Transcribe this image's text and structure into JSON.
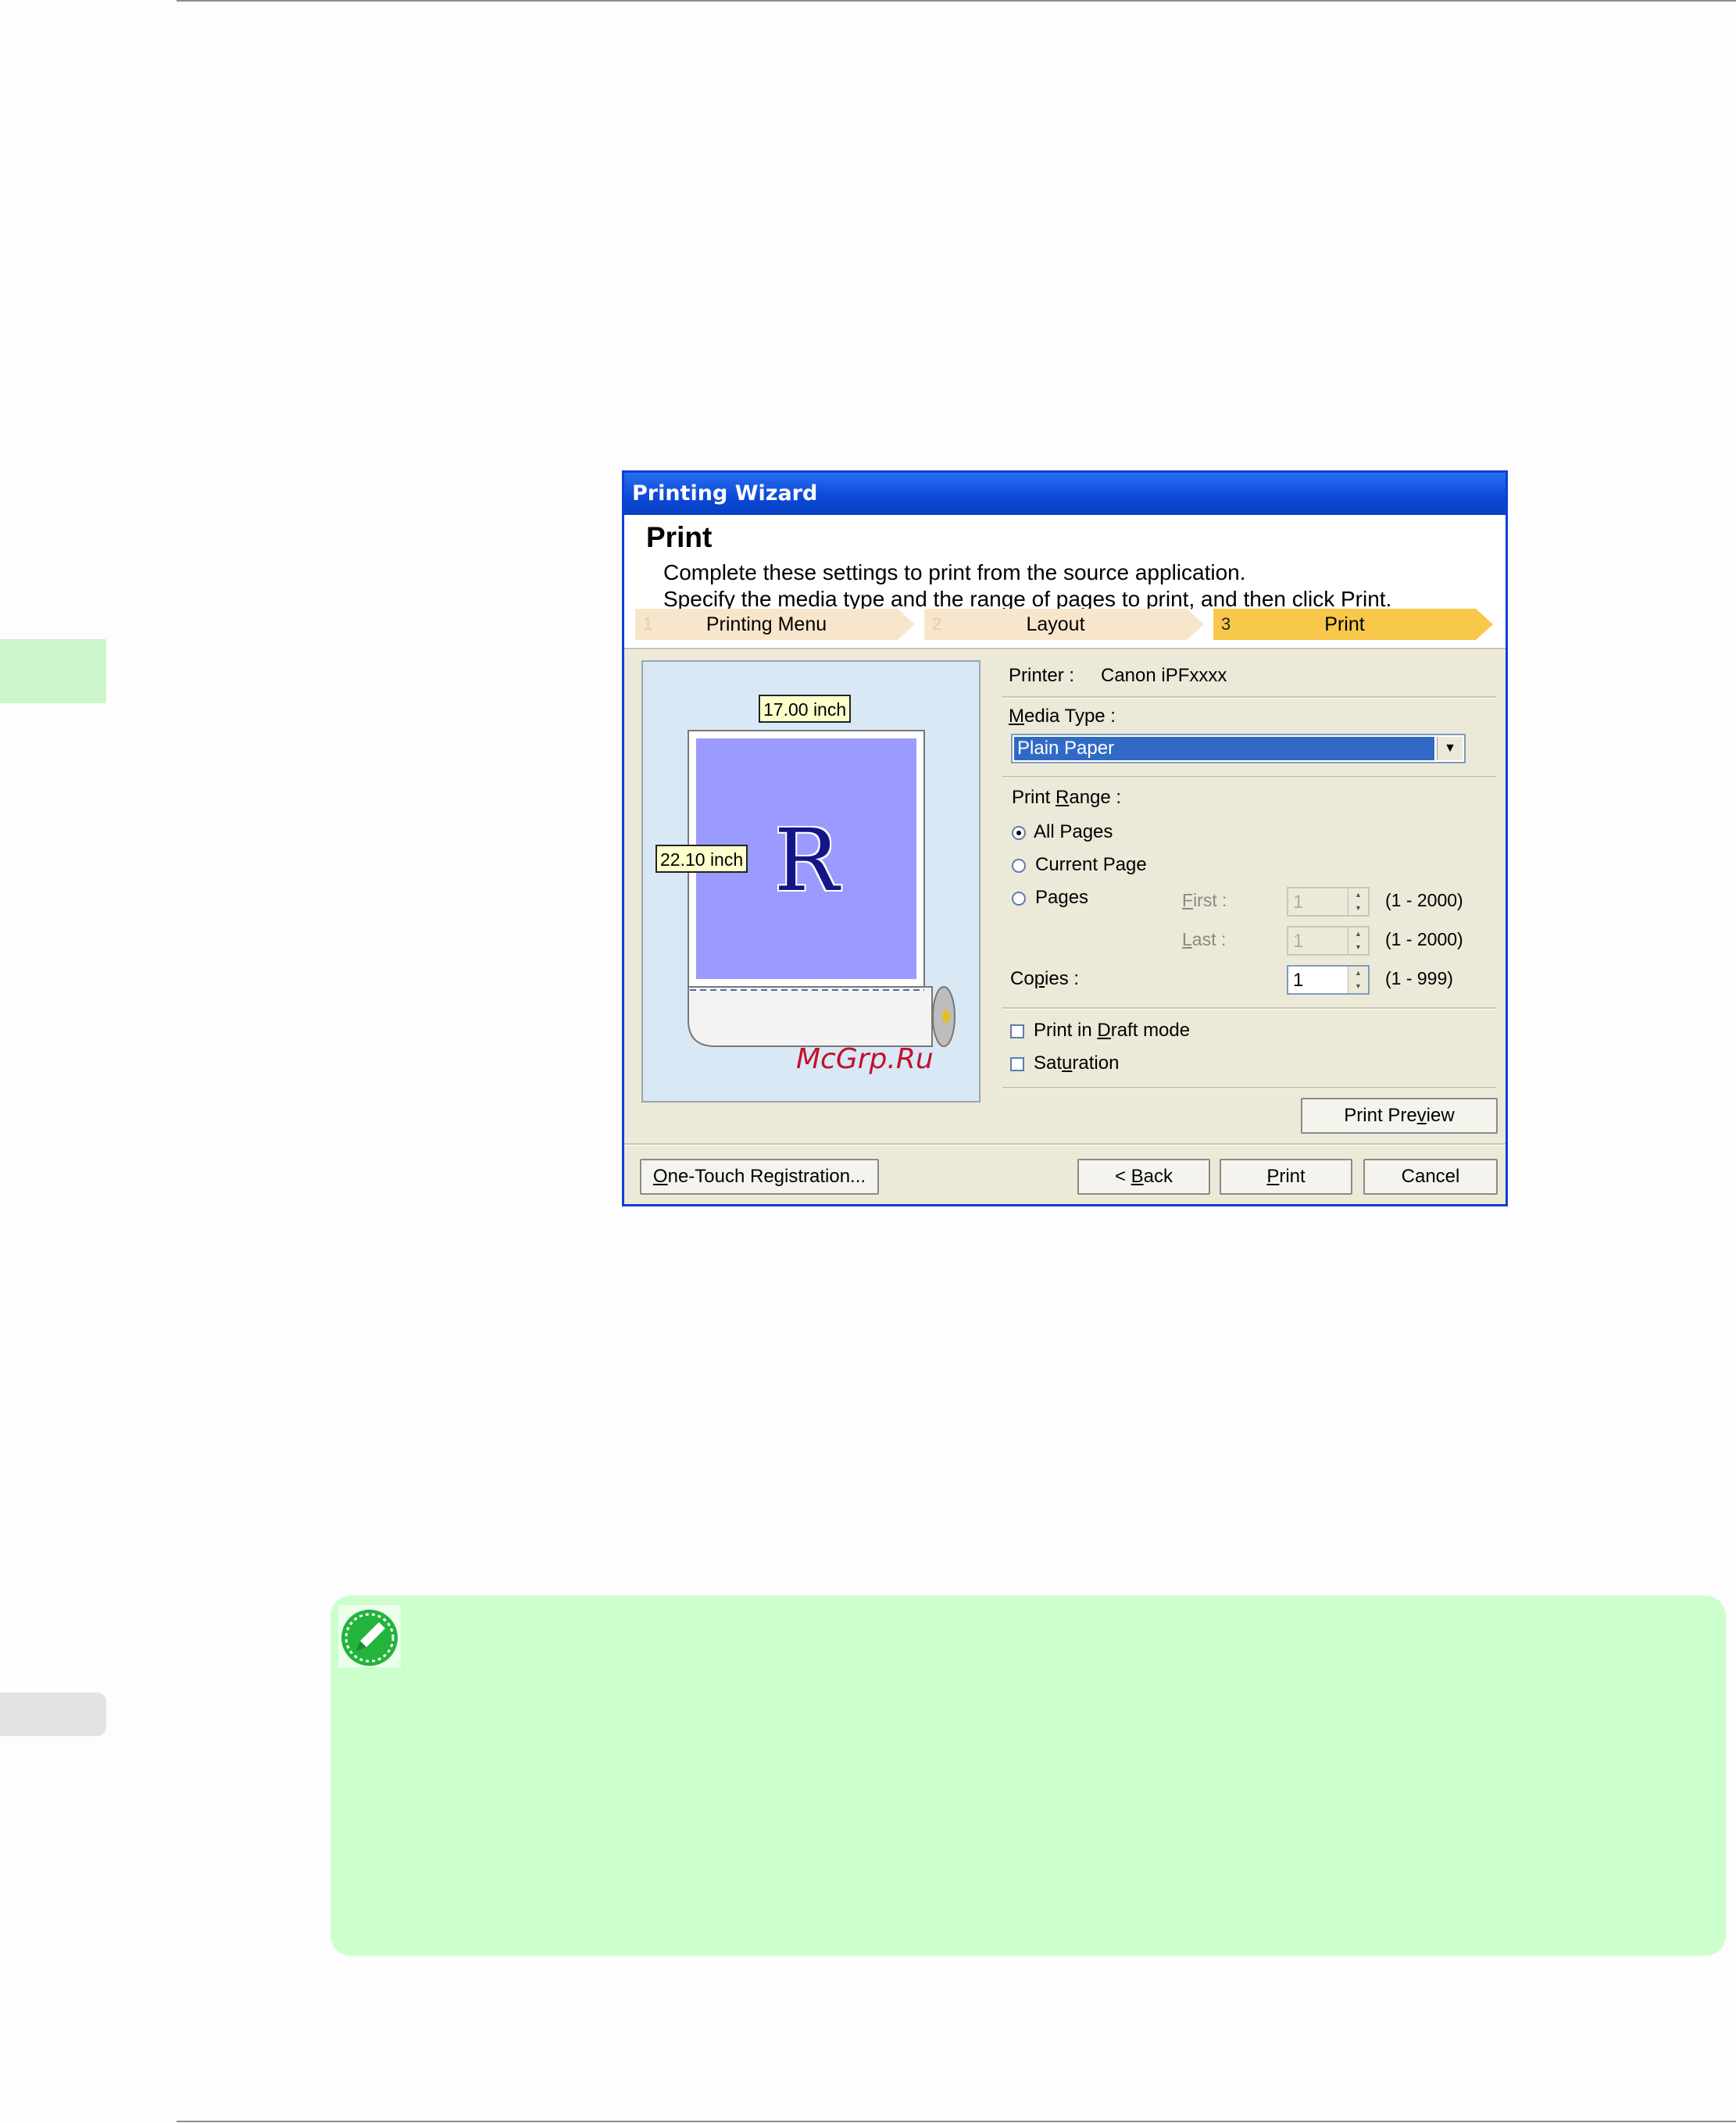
{
  "dialog": {
    "title": "Printing Wizard",
    "header_title": "Print",
    "header_line1": "Complete these settings to print from the source application.",
    "header_line2": "Specify the media type and the range of pages to print, and then click Print.",
    "steps": [
      {
        "num": "1",
        "label": "Printing Menu",
        "active": false
      },
      {
        "num": "2",
        "label": "Layout",
        "active": false
      },
      {
        "num": "3",
        "label": "Print",
        "active": true
      }
    ],
    "preview": {
      "width_label": "17.00 inch",
      "height_label": "22.10 inch",
      "letter": "R",
      "watermark": "McGrp.Ru"
    },
    "printer_label": "Printer :",
    "printer_value": "Canon iPFxxxx",
    "media_type_label_pre": "M",
    "media_type_label_post": "edia Type :",
    "media_type_value": "Plain Paper",
    "print_range_label_pre": "Print ",
    "print_range_label_u": "R",
    "print_range_label_post": "ange :",
    "radio_all": "All Pages",
    "radio_current": "Current Page",
    "radio_pages": "Pages",
    "first_label_u": "F",
    "first_label_post": "irst :",
    "first_value": "1",
    "first_range": "(1 - 2000)",
    "last_label_u": "L",
    "last_label_post": "ast :",
    "last_value": "1",
    "last_range": "(1 - 2000)",
    "copies_label_pre": "Co",
    "copies_label_u": "p",
    "copies_label_post": "ies :",
    "copies_value": "1",
    "copies_range": "(1 - 999)",
    "draft_pre": "Print in ",
    "draft_u": "D",
    "draft_post": "raft mode",
    "sat_pre": "Sat",
    "sat_u": "u",
    "sat_post": "ration",
    "preview_btn_pre": "Print Pre",
    "preview_btn_u": "v",
    "preview_btn_post": "iew",
    "onetouch_u": "O",
    "onetouch_post": "ne-Touch Registration...",
    "back_pre": "< ",
    "back_u": "B",
    "back_post": "ack",
    "print_u": "P",
    "print_post": "rint",
    "cancel_label": "Cancel"
  }
}
